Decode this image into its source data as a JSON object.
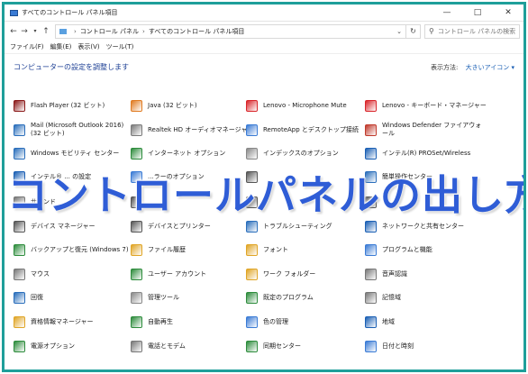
{
  "window": {
    "title": "すべてのコントロール パネル項目",
    "buttons": [
      "—",
      "□",
      "✕"
    ]
  },
  "address": {
    "nav": [
      "←",
      "→",
      "↑",
      "↑"
    ],
    "crumbs": [
      "コントロール パネル",
      "すべてのコントロール パネル項目"
    ],
    "refresh": "↻",
    "search_placeholder": "コントロール パネルの検索"
  },
  "menu": [
    "ファイル(F)",
    "編集(E)",
    "表示(V)",
    "ツール(T)"
  ],
  "header": {
    "heading": "コンピューターの設定を調整します",
    "view_by_label": "表示方法:",
    "view_by_value": "大きいアイコン ▾"
  },
  "overlay_title": "コントロールパネルの出し方",
  "items": [
    {
      "label": "Flash Player (32 ビット)",
      "icon": "flash-player-icon",
      "color": "#8b1a1a"
    },
    {
      "label": "Java (32 ビット)",
      "icon": "java-icon",
      "color": "#e07b22"
    },
    {
      "label": "Lenovo - Microphone Mute",
      "icon": "lenovo-mic-icon",
      "color": "#d9252a"
    },
    {
      "label": "Lenovo - キーボード・マネージャー",
      "icon": "lenovo-keyboard-icon",
      "color": "#d9252a"
    },
    {
      "label": "Mail (Microsoft Outlook 2016) (32 ビット)",
      "icon": "mail-icon",
      "color": "#2a6ebb"
    },
    {
      "label": "Realtek HD オーディオマネージャ",
      "icon": "realtek-icon",
      "color": "#7a7a7a"
    },
    {
      "label": "RemoteApp とデスクトップ接続",
      "icon": "remoteapp-icon",
      "color": "#3a7bd5"
    },
    {
      "label": "Windows Defender ファイアウォール",
      "icon": "firewall-icon",
      "color": "#c0392b"
    },
    {
      "label": "Windows モビリティ センター",
      "icon": "mobility-icon",
      "color": "#2a6ebb"
    },
    {
      "label": "インターネット オプション",
      "icon": "internet-options-icon",
      "color": "#2d8c3c"
    },
    {
      "label": "インデックスのオプション",
      "icon": "indexing-icon",
      "color": "#888888"
    },
    {
      "label": "インテル(R) PROSet/Wireless",
      "icon": "intel-wireless-icon",
      "color": "#1a5fb4"
    },
    {
      "label": "インテル® ... の設定",
      "icon": "intel-graphics-icon",
      "color": "#1a5fb4"
    },
    {
      "label": "...ラーのオプション",
      "icon": "color-options-icon",
      "color": "#3a7bd5"
    },
    {
      "label": "",
      "icon": "app-icon",
      "color": "#555555"
    },
    {
      "label": "簡単操作センター",
      "icon": "ease-of-access-icon",
      "color": "#2a6ebb"
    },
    {
      "label": "サウンド",
      "icon": "sound-icon",
      "color": "#777777"
    },
    {
      "label": "",
      "icon": "app-icon",
      "color": "#555555"
    },
    {
      "label": "",
      "icon": "app-icon",
      "color": "#555555"
    },
    {
      "label": "",
      "icon": "app-icon",
      "color": "#555555"
    },
    {
      "label": "デバイス マネージャー",
      "icon": "device-manager-icon",
      "color": "#555555"
    },
    {
      "label": "デバイスとプリンター",
      "icon": "printer-icon",
      "color": "#555555"
    },
    {
      "label": "トラブルシューティング",
      "icon": "troubleshooting-icon",
      "color": "#2a6ebb"
    },
    {
      "label": "ネットワークと共有センター",
      "icon": "network-icon",
      "color": "#1a5fb4"
    },
    {
      "label": "バックアップと復元 (Windows 7)",
      "icon": "backup-icon",
      "color": "#2d8c3c"
    },
    {
      "label": "ファイル履歴",
      "icon": "file-history-icon",
      "color": "#e0a526"
    },
    {
      "label": "フォント",
      "icon": "fonts-icon",
      "color": "#e0a526"
    },
    {
      "label": "プログラムと機能",
      "icon": "programs-icon",
      "color": "#3a7bd5"
    },
    {
      "label": "マウス",
      "icon": "mouse-icon",
      "color": "#777777"
    },
    {
      "label": "ユーザー アカウント",
      "icon": "user-accounts-icon",
      "color": "#2d8c3c"
    },
    {
      "label": "ワーク フォルダー",
      "icon": "work-folders-icon",
      "color": "#e0a526"
    },
    {
      "label": "音声認識",
      "icon": "speech-icon",
      "color": "#777777"
    },
    {
      "label": "回復",
      "icon": "recovery-icon",
      "color": "#2a6ebb"
    },
    {
      "label": "管理ツール",
      "icon": "admin-tools-icon",
      "color": "#888888"
    },
    {
      "label": "既定のプログラム",
      "icon": "default-programs-icon",
      "color": "#2d8c3c"
    },
    {
      "label": "記憶域",
      "icon": "storage-icon",
      "color": "#777777"
    },
    {
      "label": "資格情報マネージャー",
      "icon": "credential-icon",
      "color": "#e0a526"
    },
    {
      "label": "自動再生",
      "icon": "autoplay-icon",
      "color": "#2d8c3c"
    },
    {
      "label": "色の管理",
      "icon": "color-management-icon",
      "color": "#3a7bd5"
    },
    {
      "label": "地域",
      "icon": "region-icon",
      "color": "#1a5fb4"
    },
    {
      "label": "電源オプション",
      "icon": "power-icon",
      "color": "#2d8c3c"
    },
    {
      "label": "電話とモデム",
      "icon": "phone-modem-icon",
      "color": "#777777"
    },
    {
      "label": "同期センター",
      "icon": "sync-icon",
      "color": "#2d8c3c"
    },
    {
      "label": "日付と時刻",
      "icon": "date-time-icon",
      "color": "#3a7bd5"
    }
  ]
}
